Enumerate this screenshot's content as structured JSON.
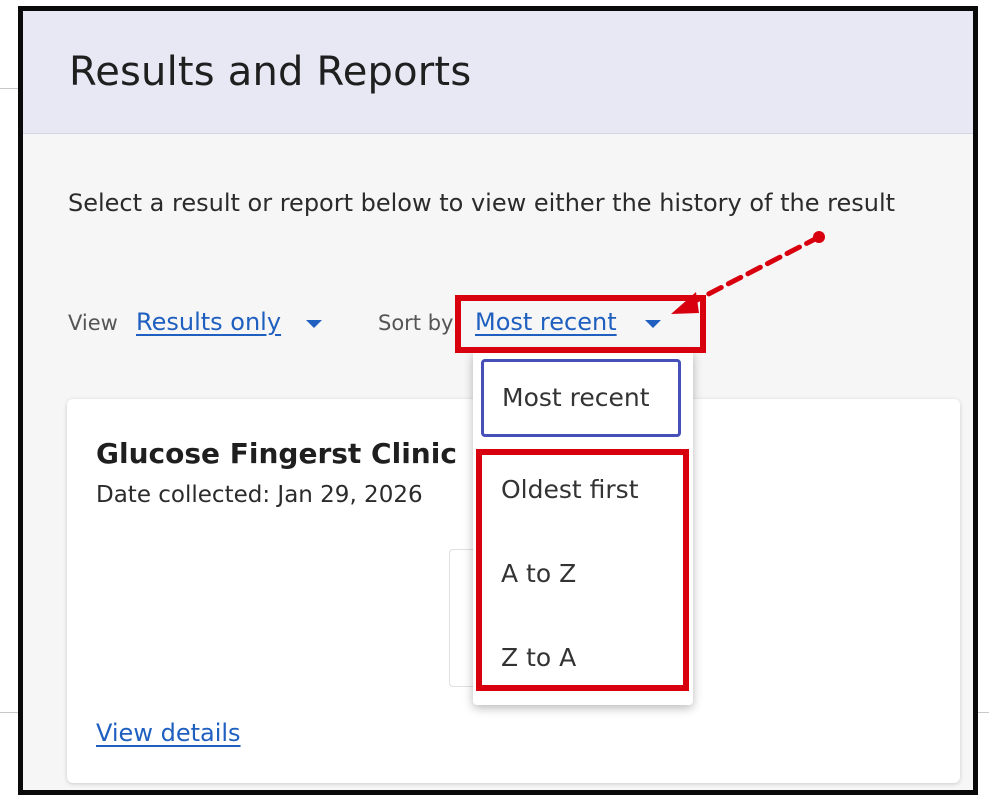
{
  "header": {
    "title": "Results and Reports"
  },
  "intro": {
    "text": "Select a result or report below to view either the history of the result"
  },
  "controls": {
    "view_label": "View",
    "view_value": "Results only",
    "sort_label": "Sort by",
    "sort_value": "Most recent"
  },
  "sort_menu": {
    "options": [
      "Most recent",
      "Oldest first",
      "A to Z",
      "Z to A"
    ],
    "selected": "Most recent"
  },
  "card": {
    "title": "Glucose Fingerst Clinic",
    "date": "Date collected: Jan 29, 2026",
    "link": "View details"
  },
  "annotation_colors": {
    "highlight": "#d8000f",
    "link": "#1f5fbf",
    "selected_border": "#4650b8"
  }
}
